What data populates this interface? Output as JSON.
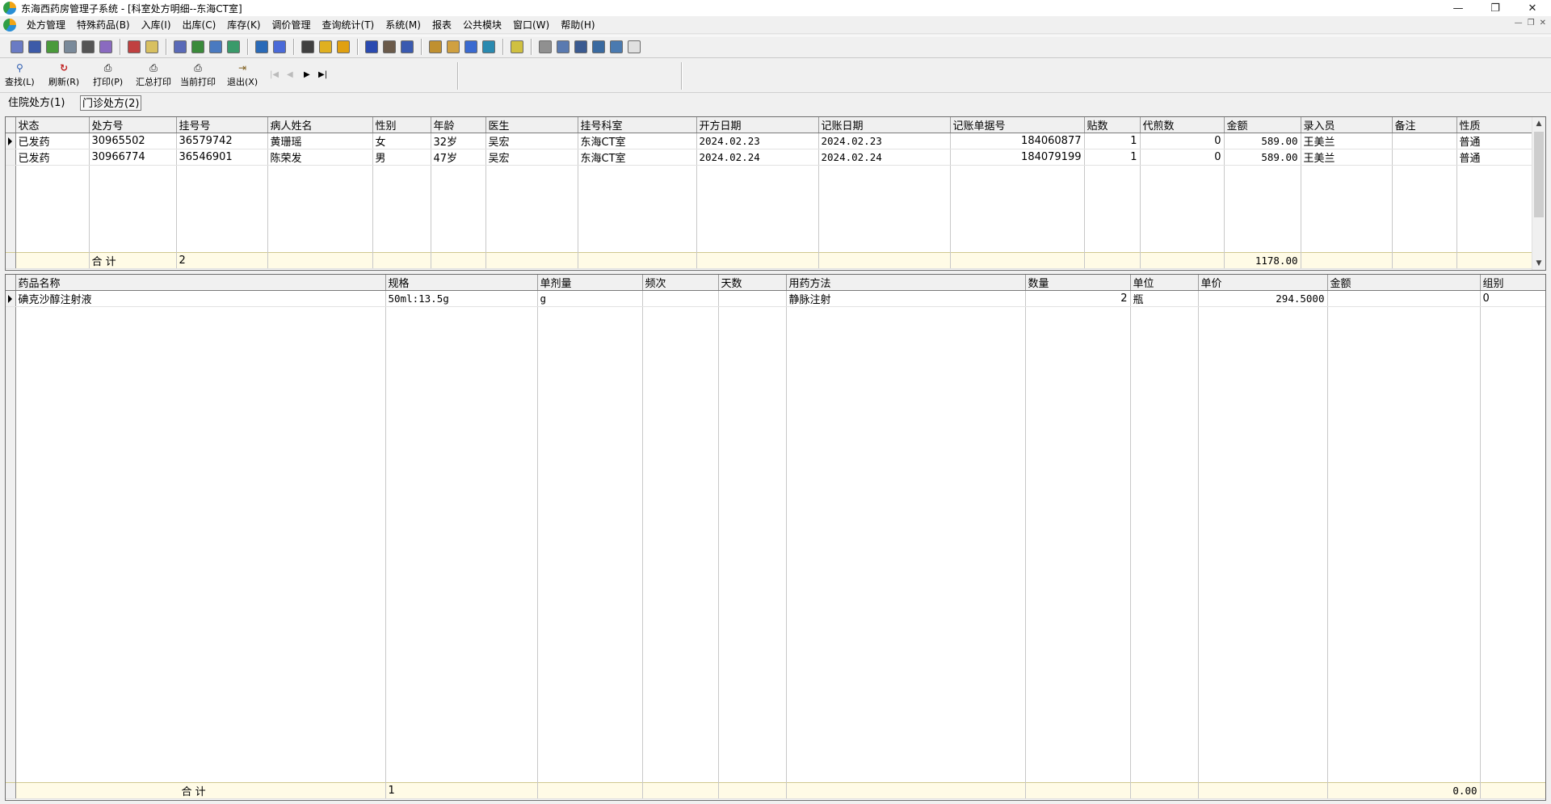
{
  "window": {
    "title": "东海西药房管理子系统 - [科室处方明细--东海CT室]",
    "minimize": "—",
    "restore": "❐",
    "close": "✕"
  },
  "menu": {
    "items": [
      "处方管理",
      "特殊药品(B)",
      "入库(I)",
      "出库(C)",
      "库存(K)",
      "调价管理",
      "查询统计(T)",
      "系统(M)",
      "报表",
      "公共模块",
      "窗口(W)",
      "帮助(H)"
    ],
    "mdi_minimize": "—",
    "mdi_restore": "❐",
    "mdi_close": "✕"
  },
  "toolbar": {
    "find": "查找(L)",
    "refresh": "刷新(R)",
    "print": "打印(P)",
    "summary_print": "汇总打印",
    "current_print": "当前打印",
    "exit": "退出(X)",
    "nav_first": "|◀",
    "nav_prev": "◀",
    "nav_next": "▶",
    "nav_last": "▶|"
  },
  "tabs": {
    "inpatient": "住院处方(1)",
    "outpatient": "门诊处方(2)"
  },
  "prescriptions": {
    "columns": [
      "状态",
      "处方号",
      "挂号号",
      "病人姓名",
      "性别",
      "年龄",
      "医生",
      "挂号科室",
      "开方日期",
      "记账日期",
      "记账单据号",
      "贴数",
      "代煎数",
      "金额",
      "录入员",
      "备注",
      "性质"
    ],
    "rows": [
      [
        "已发药",
        "30965502",
        "36579742",
        "黄珊瑶",
        "女",
        "32岁",
        "吴宏",
        "东海CT室",
        "2024.02.23",
        "2024.02.23",
        "184060877",
        "1",
        "0",
        "589.00",
        "王美兰",
        "",
        "普通"
      ],
      [
        "已发药",
        "30966774",
        "36546901",
        "陈荣发",
        "男",
        "47岁",
        "吴宏",
        "东海CT室",
        "2024.02.24",
        "2024.02.24",
        "184079199",
        "1",
        "0",
        "589.00",
        "王美兰",
        "",
        "普通"
      ]
    ],
    "footer": {
      "label": "合 计",
      "count": "2",
      "amount_total": "1178.00"
    }
  },
  "drugs": {
    "columns": [
      "药品名称",
      "规格",
      "单剂量",
      "频次",
      "天数",
      "用药方法",
      "数量",
      "单位",
      "单价",
      "金额",
      "组别"
    ],
    "rows": [
      [
        "碘克沙醇注射液",
        "50ml:13.5g",
        "g",
        "",
        "",
        "静脉注射",
        "2",
        "瓶",
        "294.5000",
        "",
        "0"
      ]
    ],
    "footer": {
      "label": "合 计",
      "count": "1",
      "amount_total": "0.00"
    }
  },
  "scroll": {
    "up": "▲",
    "down": "▼"
  }
}
